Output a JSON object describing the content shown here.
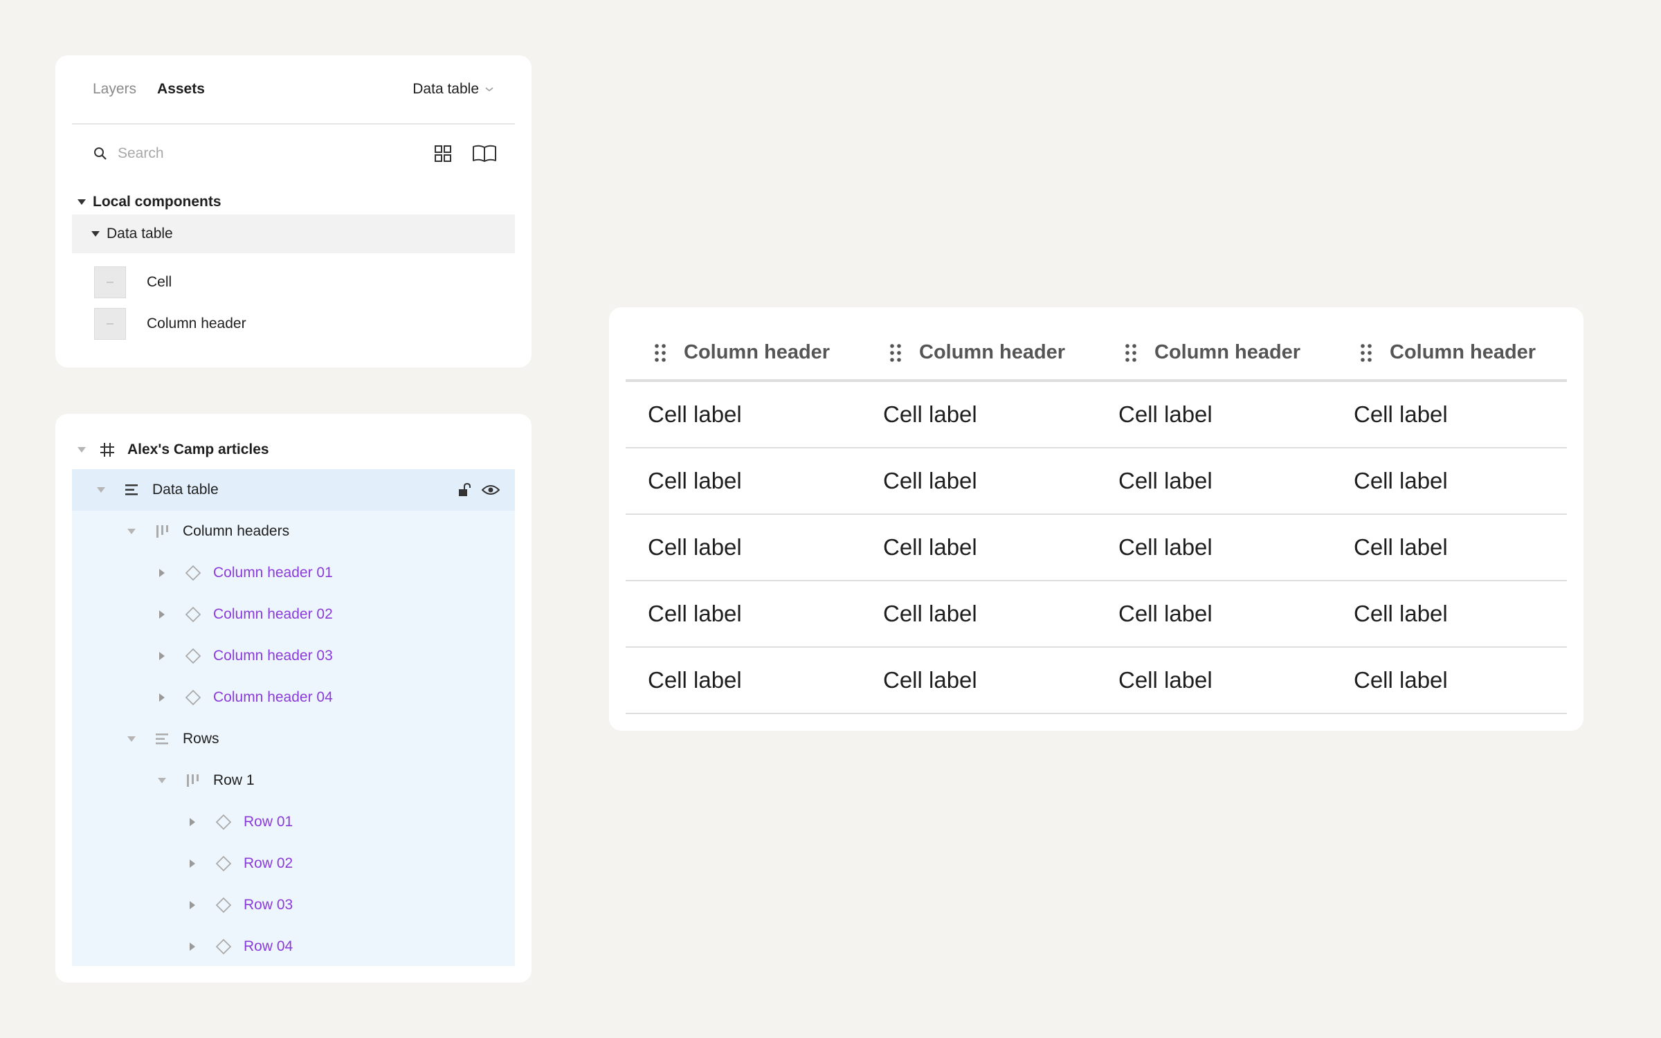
{
  "assets_panel": {
    "tabs": [
      {
        "label": "Layers",
        "active": false
      },
      {
        "label": "Assets",
        "active": true
      }
    ],
    "library_select": "Data table",
    "search": {
      "placeholder": "Search",
      "value": ""
    },
    "local_components_label": "Local components",
    "group_label": "Data table",
    "components": [
      {
        "label": "Cell"
      },
      {
        "label": "Column header"
      }
    ]
  },
  "layers_panel": {
    "frame_label": "Alex's Camp articles",
    "selected_layer": "Data table",
    "layers": [
      {
        "label": "Data table",
        "depth": 0,
        "icon": "vertical-stack-icon",
        "expanded": true,
        "component": false
      },
      {
        "label": "Column headers",
        "depth": 1,
        "icon": "horizontal-stack-icon",
        "expanded": true,
        "component": false
      },
      {
        "label": "Column header 01",
        "depth": 2,
        "icon": "component-instance-icon",
        "expanded": false,
        "component": true
      },
      {
        "label": "Column header 02",
        "depth": 2,
        "icon": "component-instance-icon",
        "expanded": false,
        "component": true
      },
      {
        "label": "Column header 03",
        "depth": 2,
        "icon": "component-instance-icon",
        "expanded": false,
        "component": true
      },
      {
        "label": "Column header 04",
        "depth": 2,
        "icon": "component-instance-icon",
        "expanded": false,
        "component": true
      },
      {
        "label": "Rows",
        "depth": 1,
        "icon": "vertical-stack-icon",
        "expanded": true,
        "component": false
      },
      {
        "label": "Row 1",
        "depth": 2,
        "icon": "horizontal-stack-icon",
        "expanded": true,
        "component": false
      },
      {
        "label": "Row 01",
        "depth": 3,
        "icon": "component-instance-icon",
        "expanded": false,
        "component": true
      },
      {
        "label": "Row 02",
        "depth": 3,
        "icon": "component-instance-icon",
        "expanded": false,
        "component": true
      },
      {
        "label": "Row 03",
        "depth": 3,
        "icon": "component-instance-icon",
        "expanded": false,
        "component": true
      },
      {
        "label": "Row 04",
        "depth": 3,
        "icon": "component-instance-icon",
        "expanded": false,
        "component": true
      }
    ]
  },
  "data_table": {
    "headers": [
      "Column header",
      "Column header",
      "Column header",
      "Column header"
    ],
    "rows": [
      [
        "Cell label",
        "Cell label",
        "Cell label",
        "Cell label"
      ],
      [
        "Cell label",
        "Cell label",
        "Cell label",
        "Cell label"
      ],
      [
        "Cell label",
        "Cell label",
        "Cell label",
        "Cell label"
      ],
      [
        "Cell label",
        "Cell label",
        "Cell label",
        "Cell label"
      ],
      [
        "Cell label",
        "Cell label",
        "Cell label",
        "Cell label"
      ]
    ]
  },
  "colors": {
    "background": "#f4f3ef",
    "panel": "#ffffff",
    "component_purple": "#8a3bd9",
    "selection_blue": "#e2effb",
    "selection_tint": "#eef6fd"
  }
}
